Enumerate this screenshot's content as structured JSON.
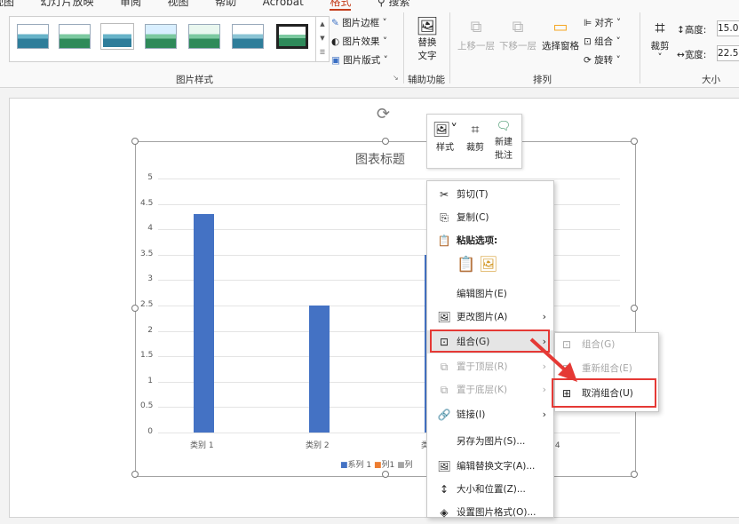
{
  "ribbon": {
    "tabs": [
      "视图",
      "幻灯片放映",
      "审阅",
      "视图",
      "帮助",
      "Acrobat",
      "格式"
    ],
    "active_tab_index": 6,
    "search_label": "搜索",
    "picture_border": "图片边框",
    "picture_effects": "图片效果",
    "picture_layout": "图片版式",
    "picture_styles_group": "图片样式",
    "alt_text_label_1": "替换",
    "alt_text_label_2": "文字",
    "accessibility_group": "辅助功能",
    "bring_forward": "上移一层",
    "send_backward": "下移一层",
    "selection_pane": "选择窗格",
    "align": "对齐",
    "group": "组合",
    "rotate": "旋转",
    "arrange_group": "排列",
    "crop": "裁剪",
    "height_label": "高度:",
    "height_value": "15.0",
    "width_label": "宽度:",
    "width_value": "22.5",
    "size_group": "大小"
  },
  "chart": {
    "title": "图表标题",
    "y_ticks": [
      "5",
      "4.5",
      "4",
      "3.5",
      "3",
      "2.5",
      "2",
      "1.5",
      "1",
      "0.5",
      "0"
    ],
    "categories": [
      "类别 1",
      "类别 2",
      "类别 3",
      "类别 4"
    ],
    "legend": [
      "系列 1",
      "列1",
      "列"
    ]
  },
  "chart_data": {
    "type": "bar",
    "title": "图表标题",
    "categories": [
      "类别 1",
      "类别 2",
      "类别 3",
      "类别 4"
    ],
    "series": [
      {
        "name": "系列 1",
        "values": [
          4.3,
          2.5,
          3.5,
          null
        ]
      }
    ],
    "ylim": [
      0,
      5
    ],
    "grid": true,
    "legend_position": "bottom",
    "colors": [
      "#4472c4"
    ]
  },
  "mini_toolbar": {
    "style": "样式",
    "crop": "裁剪",
    "new_comment_1": "新建",
    "new_comment_2": "批注"
  },
  "context_menu": {
    "items": [
      {
        "label": "剪切(T)",
        "icon": "cut-icon"
      },
      {
        "label": "复制(C)",
        "icon": "copy-icon"
      },
      {
        "label": "粘贴选项:",
        "icon": "paste-icon"
      },
      {
        "label": "编辑图片(E)",
        "icon": ""
      },
      {
        "label": "更改图片(A)",
        "icon": "change-picture-icon"
      },
      {
        "label": "组合(G)",
        "icon": "group-icon"
      },
      {
        "label": "置于顶层(R)",
        "icon": "bring-to-front-icon"
      },
      {
        "label": "置于底层(K)",
        "icon": "send-to-back-icon"
      },
      {
        "label": "链接(I)",
        "icon": "link-icon"
      },
      {
        "label": "另存为图片(S)...",
        "icon": ""
      },
      {
        "label": "编辑替换文字(A)...",
        "icon": "alt-text-icon"
      },
      {
        "label": "大小和位置(Z)...",
        "icon": "size-position-icon"
      },
      {
        "label": "设置图片格式(O)...",
        "icon": "format-picture-icon"
      }
    ]
  },
  "submenu": {
    "items": [
      "组合(G)",
      "重新组合(E)",
      "取消组合(U)"
    ]
  },
  "colors": {
    "accent": "#c43e1c",
    "bar": "#4472c4",
    "annotation": "#e53935"
  }
}
